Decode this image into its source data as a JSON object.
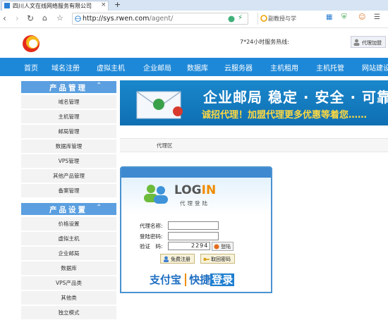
{
  "browser": {
    "tab_title": "四川人文在线网络服务有限公司",
    "tab_close": "×",
    "new_tab": "+",
    "url_domain": "http://sys.rwen.com",
    "url_path": "/agent/",
    "search_text": "副教授与学"
  },
  "header": {
    "hotline": "7*24小时服务热线:",
    "agent_join": "代理加盟"
  },
  "nav": [
    "首页",
    "域名注册",
    "虚拟主机",
    "企业邮局",
    "数据库",
    "云服务器",
    "主机租用",
    "主机托管",
    "网站建设"
  ],
  "sidebar": {
    "section1": {
      "title": "产品管理",
      "items": [
        "域名管理",
        "主机管理",
        "邮局管理",
        "数据库管理",
        "VPS管理",
        "其他产品管理",
        "备案管理"
      ]
    },
    "section2": {
      "title": "产品设置",
      "items": [
        "价格设置",
        "虚拟主机",
        "企业邮局",
        "数据库",
        "VPS产品类",
        "其他类",
        "独立模式"
      ]
    }
  },
  "banner": {
    "line1": "企业邮局 稳定 · 安全 · 可靠",
    "line2": "诚招代理！加盟代理更多优惠等着您……"
  },
  "breadcrumb": "代理区",
  "login": {
    "title_left": "LOG",
    "title_right": "IN",
    "subtitle": "代理登陆",
    "username_label": "代理名称:",
    "password_label": "登陆密码:",
    "captcha_label": "验证　码:",
    "captcha_value": "2294",
    "login_button": "登陆",
    "register_button": "免费注册",
    "retrieve_button": "取回密码",
    "alipay_brand": "支付宝",
    "alipay_quick": "快捷",
    "alipay_login": "登录"
  },
  "colors": {
    "nav_blue": "#1e88d8",
    "sidebar_head": "#5b9fe0",
    "banner_yellow": "#ffd940",
    "login_orange": "#f08c00"
  }
}
